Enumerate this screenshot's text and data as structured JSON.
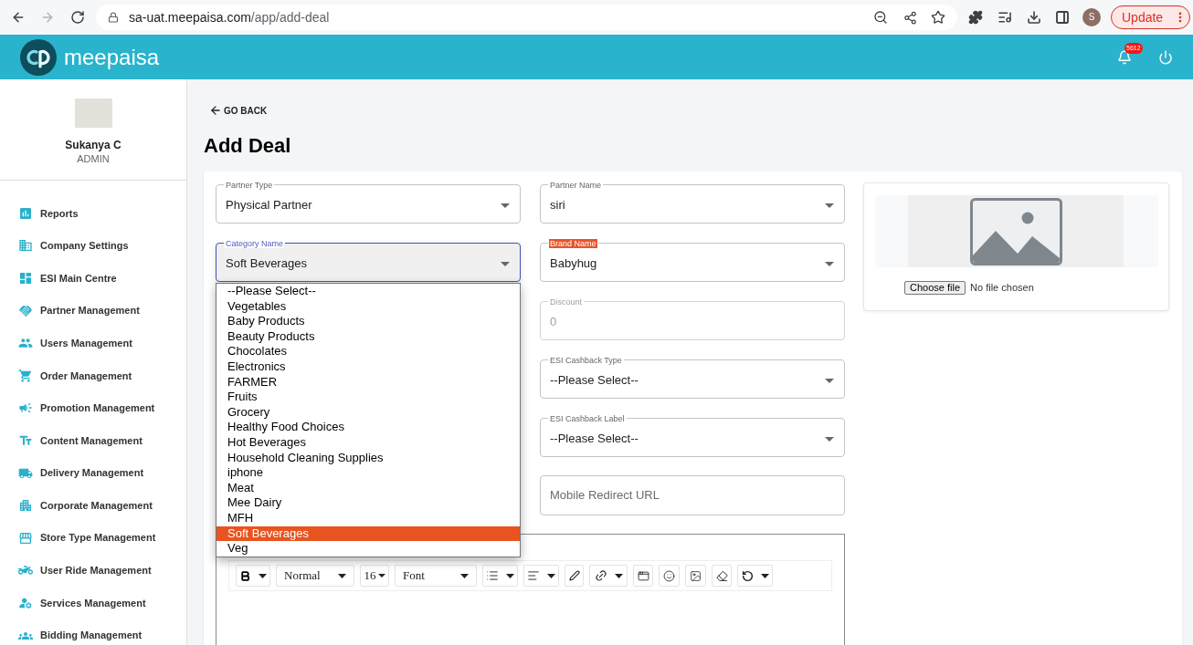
{
  "browser": {
    "url_host": "sa-uat.meepaisa.com",
    "url_path": "/app/add-deal",
    "profile_initial": "S",
    "update_label": "Update"
  },
  "header": {
    "brand": "meepaisa",
    "notification_count": "5612"
  },
  "sidebar": {
    "user_name": "Sukanya C",
    "user_role": "ADMIN",
    "items": [
      {
        "label": "Reports"
      },
      {
        "label": "Company Settings"
      },
      {
        "label": "ESI Main Centre"
      },
      {
        "label": "Partner Management"
      },
      {
        "label": "Users Management"
      },
      {
        "label": "Order Management"
      },
      {
        "label": "Promotion Management"
      },
      {
        "label": "Content Management"
      },
      {
        "label": "Delivery Management"
      },
      {
        "label": "Corporate Management"
      },
      {
        "label": "Store Type Management"
      },
      {
        "label": "User Ride Management"
      },
      {
        "label": "Services Management"
      },
      {
        "label": "Bidding Management"
      }
    ]
  },
  "page": {
    "back_label": "GO BACK",
    "title": "Add Deal"
  },
  "form": {
    "left_fields": [
      {
        "kind": "select",
        "label": "Partner Type",
        "value": "Physical Partner",
        "focused": false,
        "disabled": false,
        "label_highlighted": false
      },
      {
        "kind": "select",
        "label": "Category Name",
        "value": "Soft Beverages",
        "focused": true,
        "disabled": false,
        "label_highlighted": false,
        "options": [
          {
            "label": "--Please Select--",
            "selected": false
          },
          {
            "label": "Vegetables",
            "selected": false
          },
          {
            "label": "Baby Products",
            "selected": false
          },
          {
            "label": "Beauty Products",
            "selected": false
          },
          {
            "label": "Chocolates",
            "selected": false
          },
          {
            "label": "Electronics",
            "selected": false
          },
          {
            "label": "FARMER",
            "selected": false
          },
          {
            "label": "Fruits",
            "selected": false
          },
          {
            "label": "Grocery",
            "selected": false
          },
          {
            "label": "Healthy Food Choices",
            "selected": false
          },
          {
            "label": "Hot Beverages",
            "selected": false
          },
          {
            "label": "Household Cleaning Supplies",
            "selected": false
          },
          {
            "label": "iphone",
            "selected": false
          },
          {
            "label": "Meat",
            "selected": false
          },
          {
            "label": "Mee Dairy",
            "selected": false
          },
          {
            "label": "MFH",
            "selected": false
          },
          {
            "label": "Soft Beverages",
            "selected": true
          },
          {
            "label": "Veg",
            "selected": false
          }
        ]
      }
    ],
    "right_fields": [
      {
        "kind": "select",
        "label": "Partner Name",
        "value": "siri",
        "focused": false,
        "disabled": false,
        "label_highlighted": false
      },
      {
        "kind": "select",
        "label": "Brand Name",
        "value": "Babyhug",
        "focused": false,
        "disabled": false,
        "label_highlighted": true
      },
      {
        "kind": "input",
        "label": "Discount",
        "value": "0",
        "focused": false,
        "disabled": true,
        "label_highlighted": false
      },
      {
        "kind": "select",
        "label": "ESI Cashback Type",
        "value": "--Please Select--",
        "focused": false,
        "disabled": false,
        "label_highlighted": false
      },
      {
        "kind": "select",
        "label": "ESI Cashback Label",
        "value": "--Please Select--",
        "focused": false,
        "disabled": false,
        "label_highlighted": false
      },
      {
        "kind": "input",
        "placeholder": "Mobile Redirect URL",
        "focused": false,
        "disabled": false
      }
    ],
    "editor": {
      "block_format": "Normal",
      "font_size": "16",
      "font_family": "Font"
    }
  },
  "image_upload": {
    "button_label": "Choose file",
    "status": "No file chosen"
  }
}
